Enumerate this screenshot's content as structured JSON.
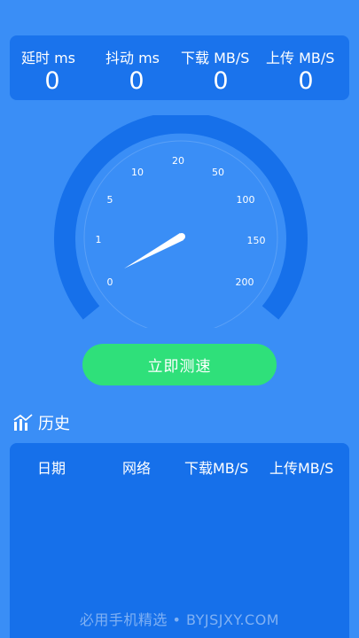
{
  "stats": {
    "latency": {
      "label": "延时 ms",
      "value": "0"
    },
    "jitter": {
      "label": "抖动 ms",
      "value": "0"
    },
    "download": {
      "label": "下载 MB/S",
      "value": "0"
    },
    "upload": {
      "label": "上传 MB/S",
      "value": "0"
    }
  },
  "gauge": {
    "ticks": [
      "0",
      "1",
      "5",
      "10",
      "20",
      "50",
      "100",
      "150",
      "200"
    ],
    "current_speed": 0
  },
  "start_button": {
    "label": "立即测速"
  },
  "history": {
    "title": "历史",
    "columns": [
      "日期",
      "网络",
      "下载MB/S",
      "上传MB/S"
    ],
    "rows": []
  },
  "watermark": "必用手机精选 • BYJSJXY.COM",
  "colors": {
    "background": "#3A8EF6",
    "panel": "#1A73EC",
    "gauge_ring": "#1670EA",
    "button": "#2FE07A"
  }
}
